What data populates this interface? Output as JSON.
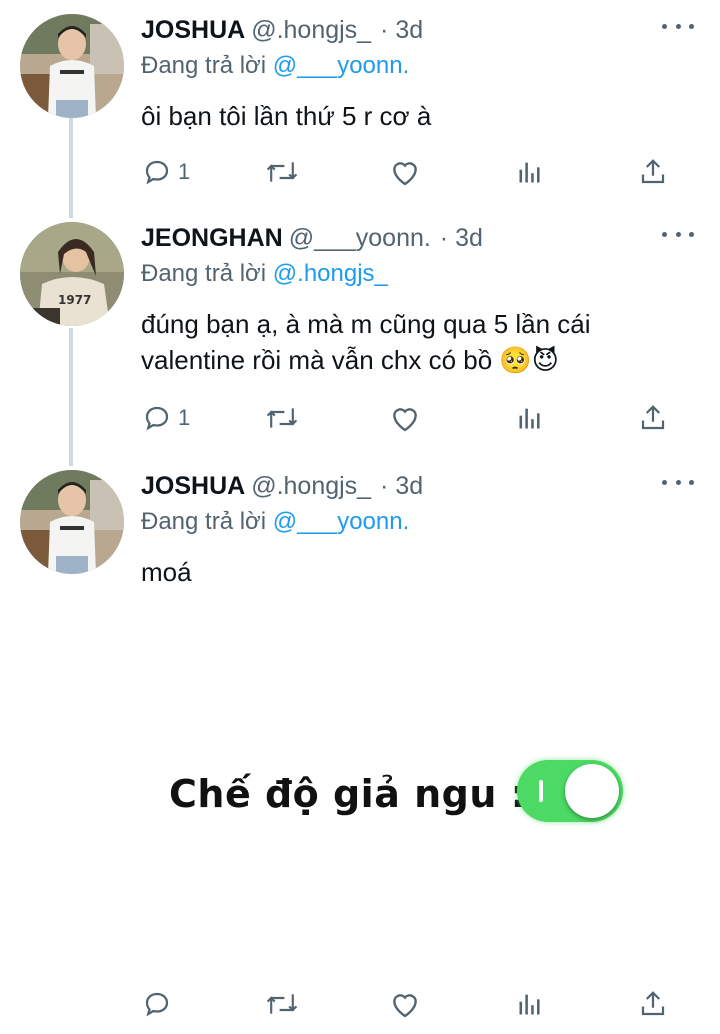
{
  "tweets": [
    {
      "name": "JOSHUA",
      "handle": "@.hongjs_",
      "sep_time": "· 3d",
      "reply_prefix": "Đang trả lời",
      "reply_mention": "@___yoonn.",
      "text": "ôi bạn tôi lần thứ 5 r cơ à",
      "reply_count": "1",
      "avatar_icon": "person-photo-avatar"
    },
    {
      "name": "JEONGHAN",
      "handle": "@___yoonn.",
      "sep_time": "· 3d",
      "reply_prefix": "Đang trả lời",
      "reply_mention": "@.hongjs_",
      "text_line1": "đúng bạn ạ, à mà m cũng qua 5 lần cái",
      "text_line2": "valentine rồi mà vẫn chx có bồ 🥺😈",
      "reply_count": "1",
      "avatar_icon": "person-photo-avatar"
    },
    {
      "name": "JOSHUA",
      "handle": "@.hongjs_",
      "sep_time": "· 3d",
      "reply_prefix": "Đang trả lời",
      "reply_mention": "@___yoonn.",
      "text": "moá",
      "reply_count": "",
      "avatar_icon": "person-photo-avatar"
    }
  ],
  "meme": {
    "text": "Chế độ giả ngu :",
    "toggle_state": "on",
    "toggle_color": "#4cd964"
  },
  "colors": {
    "mention": "#1d9bf0",
    "secondary": "#536471",
    "thread_line": "#cfd9de"
  },
  "action_icons": [
    "reply-icon",
    "retweet-icon",
    "like-icon",
    "analytics-icon",
    "share-icon"
  ]
}
